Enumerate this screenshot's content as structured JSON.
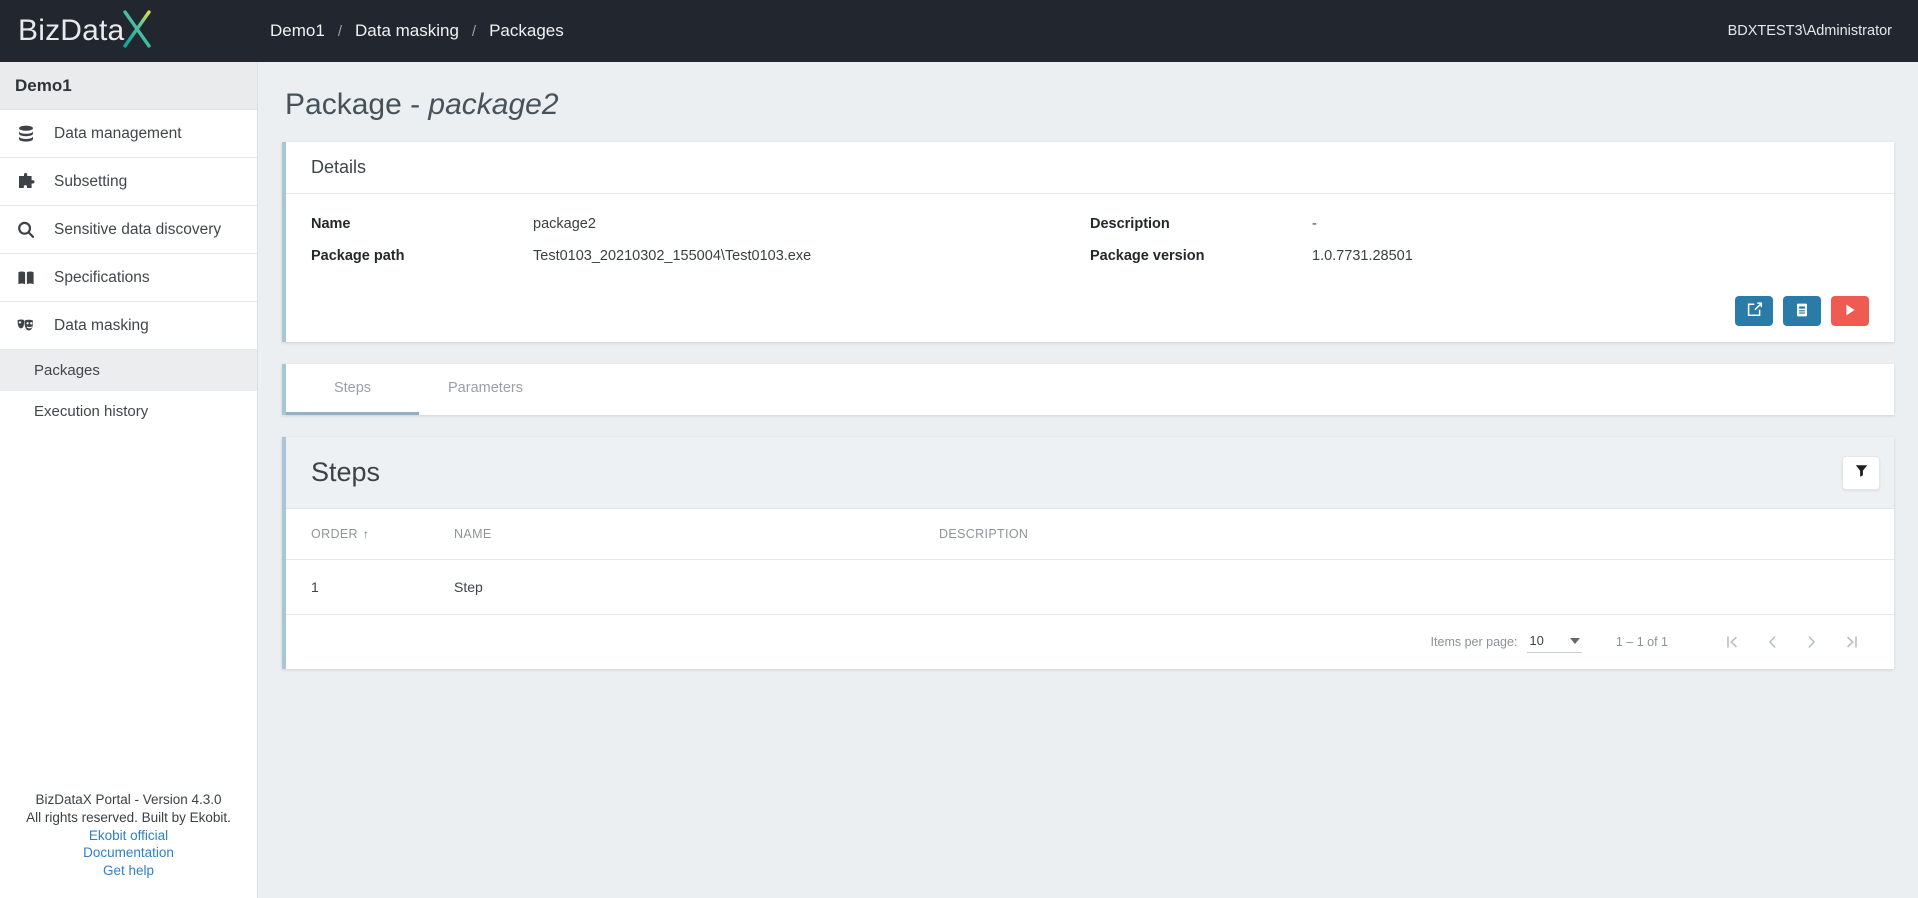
{
  "topbar": {
    "logo_text": "BizData",
    "logo_x_icon": "bizdatax-x-logo",
    "breadcrumb": [
      "Demo1",
      "Data masking",
      "Packages"
    ],
    "separator": "/",
    "user": "BDXTEST3\\Administrator"
  },
  "sidebar": {
    "header": "Demo1",
    "items": [
      {
        "label": "Data management",
        "icon": "database-icon"
      },
      {
        "label": "Subsetting",
        "icon": "puzzle-piece-icon"
      },
      {
        "label": "Sensitive data discovery",
        "icon": "magnifier-icon"
      },
      {
        "label": "Specifications",
        "icon": "open-book-icon"
      },
      {
        "label": "Data masking",
        "icon": "theater-masks-icon"
      }
    ],
    "sub_items": [
      {
        "label": "Packages",
        "active": true
      },
      {
        "label": "Execution history",
        "active": false
      }
    ],
    "footer": {
      "line1": "BizDataX Portal - Version 4.3.0",
      "line2": "All rights reserved. Built by Ekobit.",
      "links": [
        "Ekobit official",
        "Documentation",
        "Get help"
      ]
    }
  },
  "main": {
    "title_prefix": "Package - ",
    "title_name": "package2",
    "details": {
      "heading": "Details",
      "fields": [
        {
          "label": "Name",
          "value": "package2"
        },
        {
          "label": "Description",
          "value": "-"
        },
        {
          "label": "Package path",
          "value": "Test0103_20210302_155004\\Test0103.exe"
        },
        {
          "label": "Package version",
          "value": "1.0.7731.28501"
        }
      ],
      "actions": [
        {
          "name": "edit-package-button",
          "icon": "pencil-square-icon",
          "color": "#2b7ba8"
        },
        {
          "name": "package-logs-button",
          "icon": "document-icon",
          "color": "#2b7ba8"
        },
        {
          "name": "run-package-button",
          "icon": "play-icon",
          "color": "#ef5b53"
        }
      ]
    },
    "tabs": [
      {
        "label": "Steps",
        "active": true
      },
      {
        "label": "Parameters",
        "active": false
      }
    ],
    "steps": {
      "heading": "Steps",
      "filter_icon": "funnel-filter-icon",
      "columns": [
        "ORDER",
        "NAME",
        "DESCRIPTION"
      ],
      "sort_column": "ORDER",
      "sort_arrow": "↑",
      "rows": [
        {
          "order": "1",
          "name": "Step",
          "description": ""
        }
      ],
      "paginator": {
        "items_per_page_label": "Items per page:",
        "items_per_page_value": "10",
        "range_label": "1 – 1 of 1",
        "buttons": [
          "first-page",
          "previous-page",
          "next-page",
          "last-page"
        ]
      }
    }
  },
  "colors": {
    "topbar_bg": "#22262e",
    "card_accent": "#a9c6d8",
    "primary_blue": "#2b7ba8",
    "danger_red": "#ef5b53",
    "page_bg": "#eceff1",
    "link_blue": "#2f80c6"
  }
}
